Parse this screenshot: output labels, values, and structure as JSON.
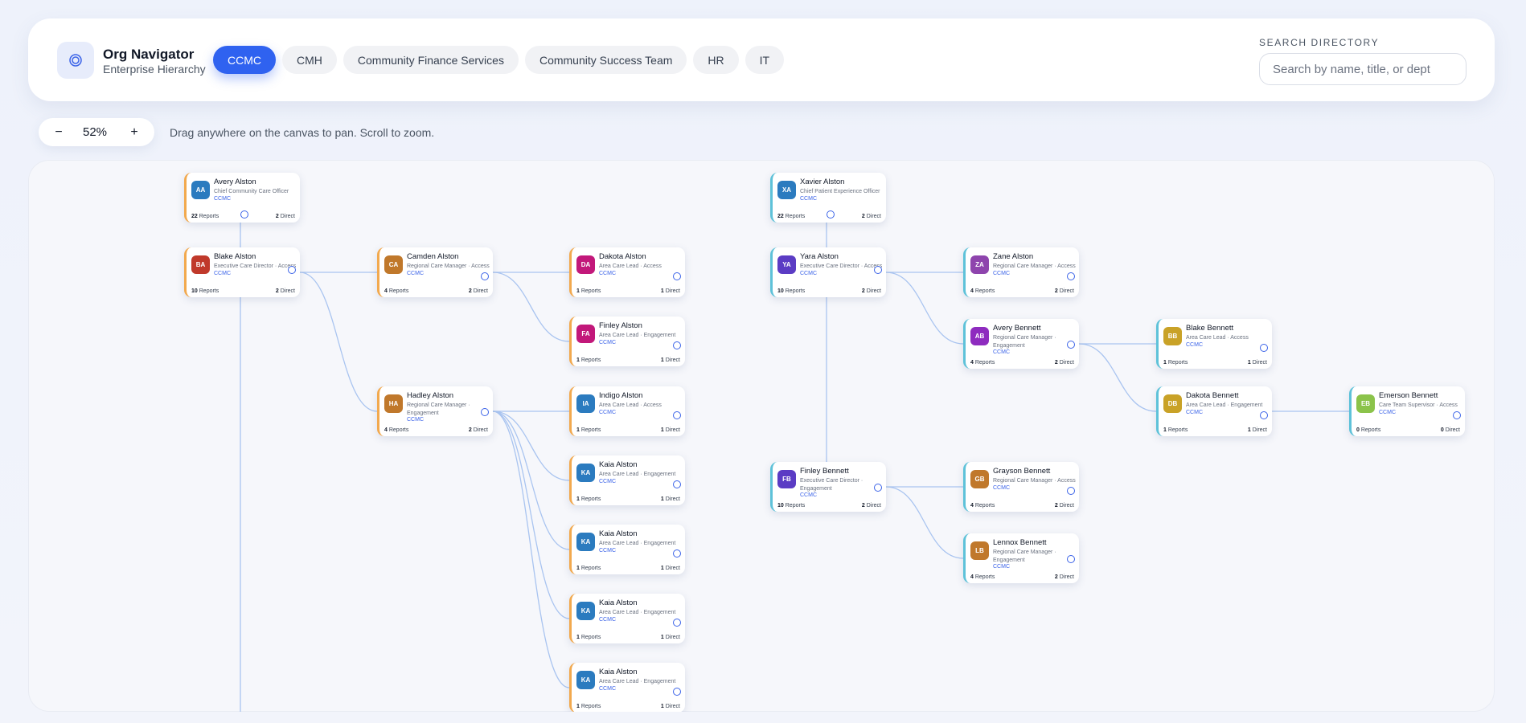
{
  "app": {
    "title": "Org Navigator",
    "subtitle": "Enterprise Hierarchy",
    "logo_icon": "target-icon",
    "accent": "#2f62f0"
  },
  "tabs": [
    {
      "label": "CCMC",
      "active": true
    },
    {
      "label": "CMH",
      "active": false
    },
    {
      "label": "Community Finance Services",
      "active": false
    },
    {
      "label": "Community Success Team",
      "active": false
    },
    {
      "label": "HR",
      "active": false
    },
    {
      "label": "IT",
      "active": false
    }
  ],
  "search": {
    "label": "SEARCH DIRECTORY",
    "placeholder": "Search by name, title, or dept",
    "value": ""
  },
  "zoom": {
    "minus": "−",
    "level": "52%",
    "plus": "+",
    "hint": "Drag anywhere on the canvas to pan. Scroll to zoom."
  },
  "labels": {
    "reports": "Reports",
    "direct": "Direct"
  },
  "nodes": [
    {
      "id": "n1",
      "initials": "AA",
      "name": "Avery Alston",
      "title": "Chief Community Care Officer",
      "dept": "CCMC",
      "reports": "22",
      "direct": "2",
      "color": "#2b7bbf",
      "accent": "orange"
    },
    {
      "id": "n2",
      "initials": "BA",
      "name": "Blake Alston",
      "title": "Executive Care Director · Access",
      "dept": "CCMC",
      "reports": "10",
      "direct": "2",
      "color": "#c0392b",
      "accent": "orange"
    },
    {
      "id": "n3",
      "initials": "CA",
      "name": "Camden Alston",
      "title": "Regional Care Manager · Access",
      "dept": "CCMC",
      "reports": "4",
      "direct": "2",
      "color": "#c0782b",
      "accent": "orange"
    },
    {
      "id": "n4",
      "initials": "DA",
      "name": "Dakota Alston",
      "title": "Area Care Lead · Access",
      "dept": "CCMC",
      "reports": "1",
      "direct": "1",
      "color": "#c2187a",
      "accent": "orange"
    },
    {
      "id": "n5",
      "initials": "FA",
      "name": "Finley Alston",
      "title": "Area Care Lead · Engagement",
      "dept": "CCMC",
      "reports": "1",
      "direct": "1",
      "color": "#c2187a",
      "accent": "orange"
    },
    {
      "id": "n6",
      "initials": "HA",
      "name": "Hadley Alston",
      "title": "Regional Care Manager · Engagement",
      "dept": "CCMC",
      "reports": "4",
      "direct": "2",
      "color": "#c0782b",
      "accent": "orange"
    },
    {
      "id": "n7",
      "initials": "IA",
      "name": "Indigo Alston",
      "title": "Area Care Lead · Access",
      "dept": "CCMC",
      "reports": "1",
      "direct": "1",
      "color": "#2b7bbf",
      "accent": "orange"
    },
    {
      "id": "n8",
      "initials": "KA",
      "name": "Kaia Alston",
      "title": "Area Care Lead · Engagement",
      "dept": "CCMC",
      "reports": "1",
      "direct": "1",
      "color": "#2b7bbf",
      "accent": "orange"
    },
    {
      "id": "n9",
      "initials": "KA",
      "name": "Kaia Alston",
      "title": "Area Care Lead · Engagement",
      "dept": "CCMC",
      "reports": "1",
      "direct": "1",
      "color": "#2b7bbf",
      "accent": "orange"
    },
    {
      "id": "n10",
      "initials": "KA",
      "name": "Kaia Alston",
      "title": "Area Care Lead · Engagement",
      "dept": "CCMC",
      "reports": "1",
      "direct": "1",
      "color": "#2b7bbf",
      "accent": "orange"
    },
    {
      "id": "n11",
      "initials": "KA",
      "name": "Kaia Alston",
      "title": "Area Care Lead · Engagement",
      "dept": "CCMC",
      "reports": "1",
      "direct": "1",
      "color": "#2b7bbf",
      "accent": "orange"
    },
    {
      "id": "n12",
      "initials": "XA",
      "name": "Xavier Alston",
      "title": "Chief Patient Experience Officer",
      "dept": "CCMC",
      "reports": "22",
      "direct": "2",
      "color": "#2b7bbf",
      "accent": "teal"
    },
    {
      "id": "n13",
      "initials": "YA",
      "name": "Yara Alston",
      "title": "Executive Care Director · Access",
      "dept": "CCMC",
      "reports": "10",
      "direct": "2",
      "color": "#5b3cc4",
      "accent": "teal"
    },
    {
      "id": "n14",
      "initials": "ZA",
      "name": "Zane Alston",
      "title": "Regional Care Manager · Access",
      "dept": "CCMC",
      "reports": "4",
      "direct": "2",
      "color": "#8e44ad",
      "accent": "teal"
    },
    {
      "id": "n15",
      "initials": "AB",
      "name": "Avery Bennett",
      "title": "Regional Care Manager · Engagement",
      "dept": "CCMC",
      "reports": "4",
      "direct": "2",
      "color": "#8e2bbf",
      "accent": "teal"
    },
    {
      "id": "n16",
      "initials": "BB",
      "name": "Blake Bennett",
      "title": "Area Care Lead · Access",
      "dept": "CCMC",
      "reports": "1",
      "direct": "1",
      "color": "#c9a227",
      "accent": "teal"
    },
    {
      "id": "n17",
      "initials": "DB",
      "name": "Dakota Bennett",
      "title": "Area Care Lead · Engagement",
      "dept": "CCMC",
      "reports": "1",
      "direct": "1",
      "color": "#c9a227",
      "accent": "teal"
    },
    {
      "id": "n18",
      "initials": "EB",
      "name": "Emerson Bennett",
      "title": "Care Team Supervisor · Access",
      "dept": "CCMC",
      "reports": "0",
      "direct": "0",
      "color": "#8bc34a",
      "accent": "teal"
    },
    {
      "id": "n19",
      "initials": "FB",
      "name": "Finley Bennett",
      "title": "Executive Care Director · Engagement",
      "dept": "CCMC",
      "reports": "10",
      "direct": "2",
      "color": "#5b3cc4",
      "accent": "teal"
    },
    {
      "id": "n20",
      "initials": "GB",
      "name": "Grayson Bennett",
      "title": "Regional Care Manager · Access",
      "dept": "CCMC",
      "reports": "4",
      "direct": "2",
      "color": "#c0782b",
      "accent": "teal"
    },
    {
      "id": "n21",
      "initials": "LB",
      "name": "Lennox Bennett",
      "title": "Regional Care Manager · Engagement",
      "dept": "CCMC",
      "reports": "4",
      "direct": "2",
      "color": "#c0782b",
      "accent": "teal"
    }
  ],
  "links": [
    [
      "n1",
      "n2"
    ],
    [
      "n2",
      "n3"
    ],
    [
      "n2",
      "n6"
    ],
    [
      "n3",
      "n4"
    ],
    [
      "n3",
      "n5"
    ],
    [
      "n6",
      "n7"
    ],
    [
      "n6",
      "n8"
    ],
    [
      "n6",
      "n9"
    ],
    [
      "n6",
      "n10"
    ],
    [
      "n6",
      "n11"
    ],
    [
      "n12",
      "n13"
    ],
    [
      "n13",
      "n14"
    ],
    [
      "n13",
      "n15"
    ],
    [
      "n15",
      "n16"
    ],
    [
      "n15",
      "n17"
    ],
    [
      "n17",
      "n18"
    ],
    [
      "n13",
      "n19"
    ],
    [
      "n19",
      "n20"
    ],
    [
      "n19",
      "n21"
    ]
  ]
}
